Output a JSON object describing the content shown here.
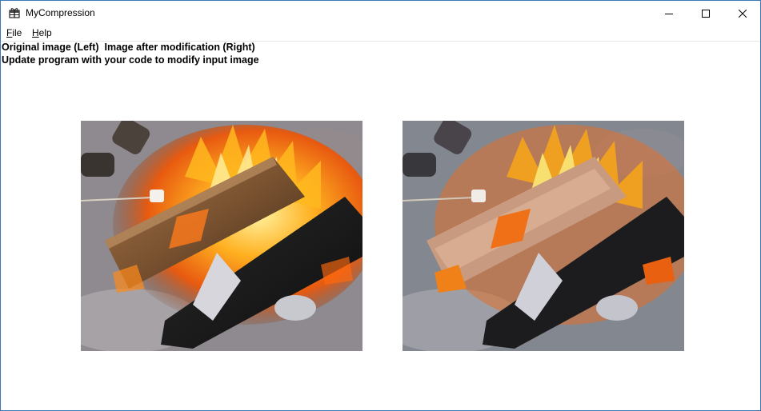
{
  "window": {
    "title": "MyCompression",
    "icon": "gift-icon",
    "controls": {
      "minimize": "minimize-icon",
      "maximize": "maximize-icon",
      "close": "close-icon"
    }
  },
  "menu": {
    "items": [
      {
        "mnemonic": "F",
        "rest": "ile"
      },
      {
        "mnemonic": "H",
        "rest": "elp"
      }
    ]
  },
  "info": {
    "line1": "Original image (Left)  Image after modification (Right)",
    "line2": "Update program with your code to modify input image"
  },
  "images": {
    "left": {
      "description_name": "original-image"
    },
    "right": {
      "description_name": "modified-image"
    }
  },
  "colors": {
    "window_border": "#3a78b8",
    "background": "#ffffff",
    "text": "#000000"
  }
}
